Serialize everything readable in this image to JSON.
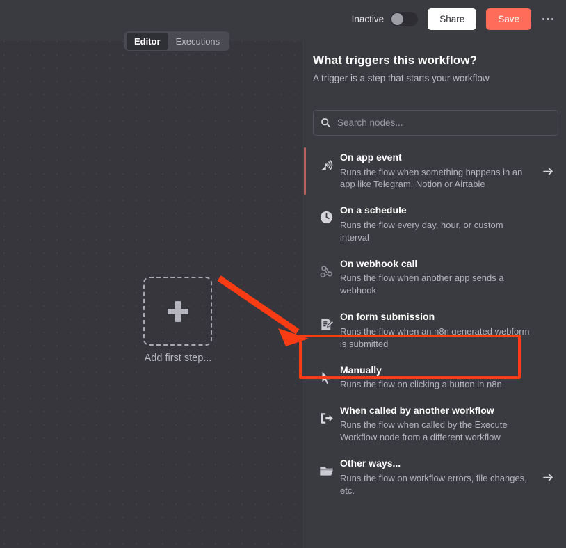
{
  "header": {
    "tabs": [
      {
        "label": "Editor",
        "active": true
      },
      {
        "label": "Executions",
        "active": false
      }
    ],
    "activation_label": "Inactive",
    "share_label": "Share",
    "save_label": "Save",
    "more_menu_icon": "ellipsis-icon",
    "accent_color": "#ff6d5a"
  },
  "canvas": {
    "add_first_step_label": "Add first step...",
    "add_first_step_icon": "plus-icon"
  },
  "annotation": {
    "arrow_color": "#f93c13",
    "highlight_color": "#f93c13",
    "highlight_target": "Manually"
  },
  "panel": {
    "title": "What triggers this workflow?",
    "subtitle": "A trigger is a step that starts your workflow",
    "search": {
      "placeholder": "Search nodes...",
      "value": "",
      "icon": "search-icon"
    },
    "nodes": [
      {
        "title": "On app event",
        "description": "Runs the flow when something happens in an app like Telegram, Notion or Airtable",
        "icon": "satellite-signal-icon",
        "chevron": "arrow-right-icon",
        "has_chevron": true,
        "accented": true
      },
      {
        "title": "On a schedule",
        "description": "Runs the flow every day, hour, or custom interval",
        "icon": "clock-icon",
        "chevron": "arrow-right-icon",
        "has_chevron": false,
        "accented": false
      },
      {
        "title": "On webhook call",
        "description": "Runs the flow when another app sends a webhook",
        "icon": "webhook-icon",
        "chevron": "arrow-right-icon",
        "has_chevron": false,
        "accented": false
      },
      {
        "title": "On form submission",
        "description": "Runs the flow when an n8n generated webform is submitted",
        "icon": "form-edit-icon",
        "chevron": "arrow-right-icon",
        "has_chevron": false,
        "accented": false
      },
      {
        "title": "Manually",
        "description": "Runs the flow on clicking a button in n8n",
        "icon": "cursor-pointer-icon",
        "chevron": "arrow-right-icon",
        "has_chevron": false,
        "accented": false
      },
      {
        "title": "When called by another workflow",
        "description": "Runs the flow when called by the Execute Workflow node from a different workflow",
        "icon": "sign-out-icon",
        "chevron": "arrow-right-icon",
        "has_chevron": false,
        "accented": false
      },
      {
        "title": "Other ways...",
        "description": "Runs the flow on workflow errors, file changes, etc.",
        "icon": "folder-open-icon",
        "chevron": "arrow-right-icon",
        "has_chevron": true,
        "accented": false
      }
    ]
  }
}
